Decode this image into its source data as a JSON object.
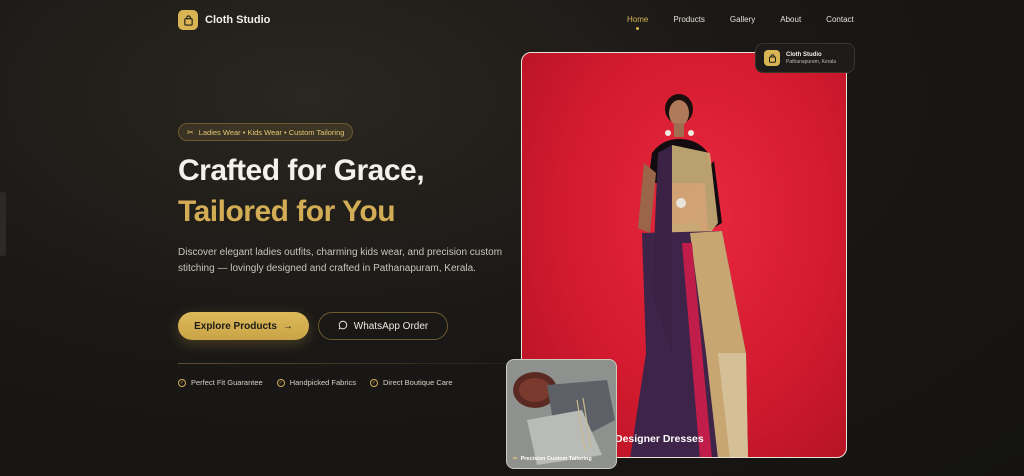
{
  "brand": {
    "name": "Cloth Studio"
  },
  "nav": {
    "items": [
      {
        "label": "Home",
        "active": true
      },
      {
        "label": "Products",
        "active": false
      },
      {
        "label": "Gallery",
        "active": false
      },
      {
        "label": "About",
        "active": false
      },
      {
        "label": "Contact",
        "active": false
      }
    ]
  },
  "hero": {
    "tagline": "Ladies Wear • Kids Wear • Custom Tailoring",
    "title_line1": "Crafted for Grace,",
    "title_line2": "Tailored for You",
    "description": "Discover elegant ladies outfits, charming kids wear, and precision custom stitching — lovingly designed and crafted in Pathanapuram, Kerala.",
    "primary_button": "Explore Products",
    "secondary_button": "WhatsApp Order",
    "features": [
      "Perfect Fit Guarantee",
      "Handpicked Fabrics",
      "Direct Boutique Care"
    ]
  },
  "gallery": {
    "main_caption": "Designer Dresses",
    "secondary_caption": "Precision Custom Tailoring"
  },
  "store_card": {
    "name": "Cloth Studio",
    "location": "Pathanapuram, Kerala"
  },
  "colors": {
    "accent": "#d8b454",
    "background": "#1a1816",
    "hero_bg": "#d21a2e"
  }
}
